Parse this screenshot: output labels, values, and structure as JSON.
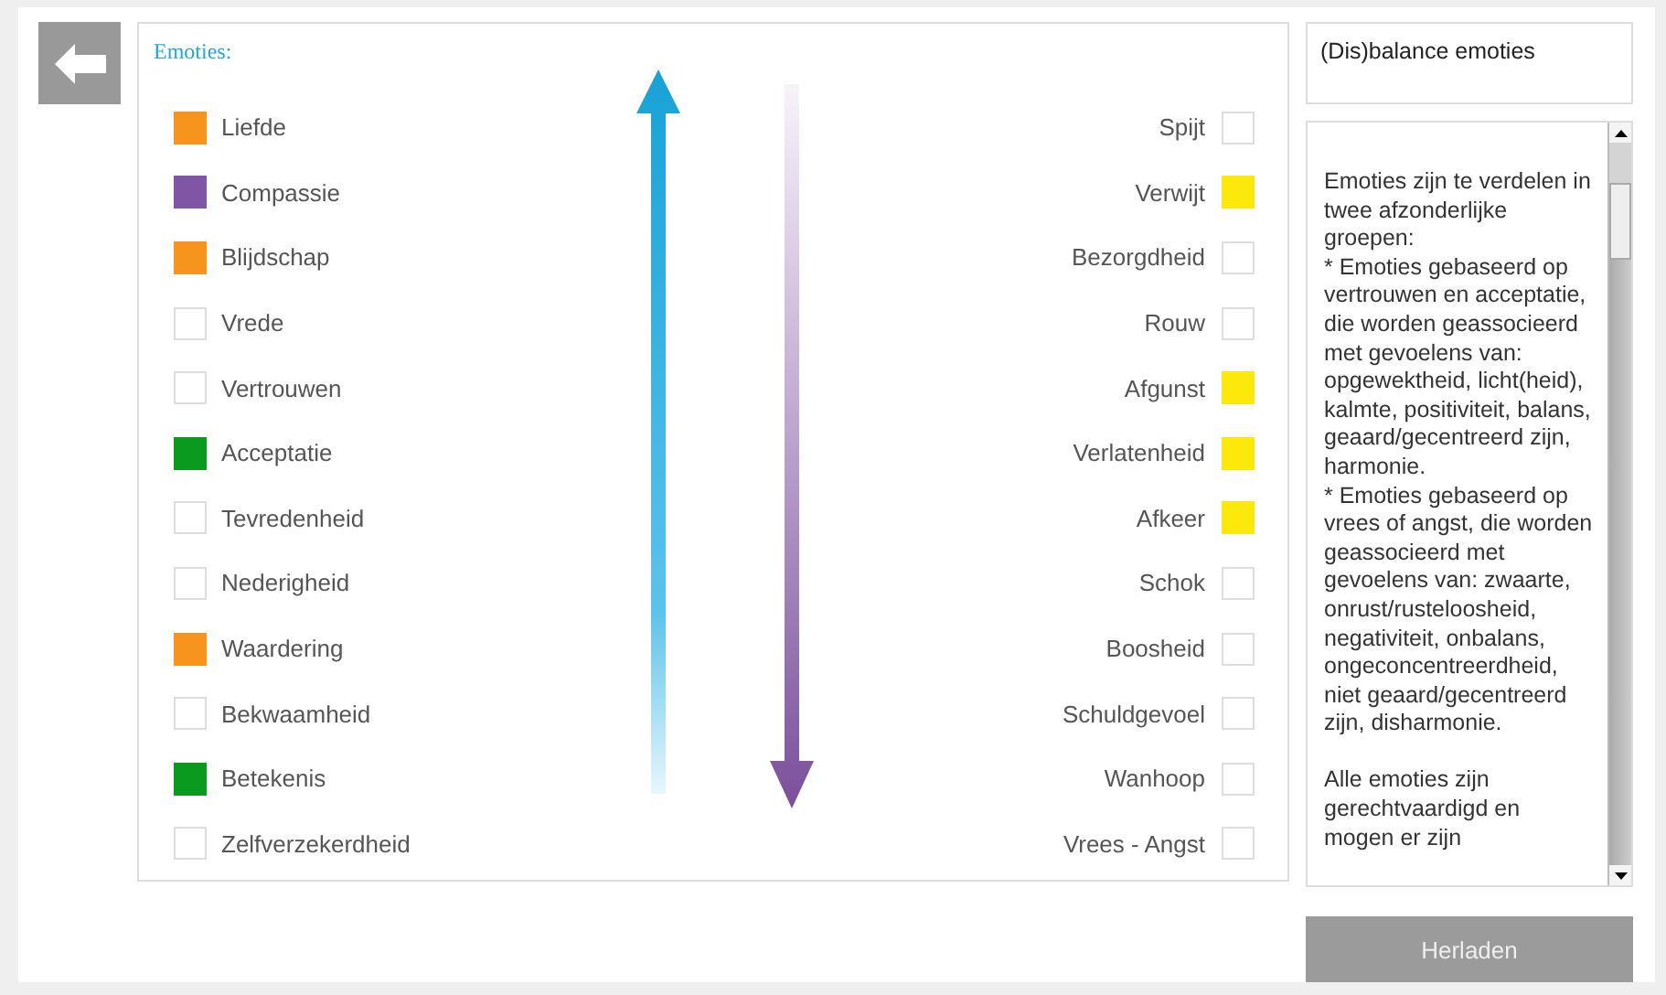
{
  "panel": {
    "title": "Emoties:"
  },
  "left_emotions": [
    {
      "label": "Liefde",
      "checked": true,
      "color": "#f7941d"
    },
    {
      "label": "Compassie",
      "checked": true,
      "color": "#8155a5"
    },
    {
      "label": "Blijdschap",
      "checked": true,
      "color": "#f7941d"
    },
    {
      "label": "Vrede",
      "checked": false
    },
    {
      "label": "Vertrouwen",
      "checked": false
    },
    {
      "label": "Acceptatie",
      "checked": true,
      "color": "#0a9a1f"
    },
    {
      "label": "Tevredenheid",
      "checked": false
    },
    {
      "label": "Nederigheid",
      "checked": false
    },
    {
      "label": "Waardering",
      "checked": true,
      "color": "#f7941d"
    },
    {
      "label": "Bekwaamheid",
      "checked": false
    },
    {
      "label": "Betekenis",
      "checked": true,
      "color": "#0a9a1f"
    },
    {
      "label": "Zelfverzekerdheid",
      "checked": false
    }
  ],
  "right_emotions": [
    {
      "label": "Spijt",
      "checked": false
    },
    {
      "label": "Verwijt",
      "checked": true,
      "color": "#fce80a"
    },
    {
      "label": "Bezorgdheid",
      "checked": false
    },
    {
      "label": "Rouw",
      "checked": false
    },
    {
      "label": "Afgunst",
      "checked": true,
      "color": "#fce80a"
    },
    {
      "label": "Verlatenheid",
      "checked": true,
      "color": "#fce80a"
    },
    {
      "label": "Afkeer",
      "checked": true,
      "color": "#fce80a"
    },
    {
      "label": "Schok",
      "checked": false
    },
    {
      "label": "Boosheid",
      "checked": false
    },
    {
      "label": "Schuldgevoel",
      "checked": false
    },
    {
      "label": "Wanhoop",
      "checked": false
    },
    {
      "label": "Vrees - Angst",
      "checked": false
    }
  ],
  "info": {
    "title": "(Dis)balance emoties",
    "text": "Emoties zijn te verdelen in twee afzonderlijke groepen:\n* Emoties gebaseerd op vertrouwen en acceptatie, die worden geassocieerd met gevoelens van: opgewektheid, licht(heid), kalmte, positiviteit, balans, geaard/gecentreerd zijn, harmonie.\n* Emoties gebaseerd op vrees of angst, die worden geassocieerd met gevoelens van: zwaarte, onrust/rusteloosheid, negativiteit, onbalans, ongeconcentreerdheid, niet geaard/gecentreerd zijn, disharmonie.\n\nAlle emoties zijn gerechtvaardigd en mogen er zijn"
  },
  "reload_button": {
    "label": "Herladen"
  }
}
